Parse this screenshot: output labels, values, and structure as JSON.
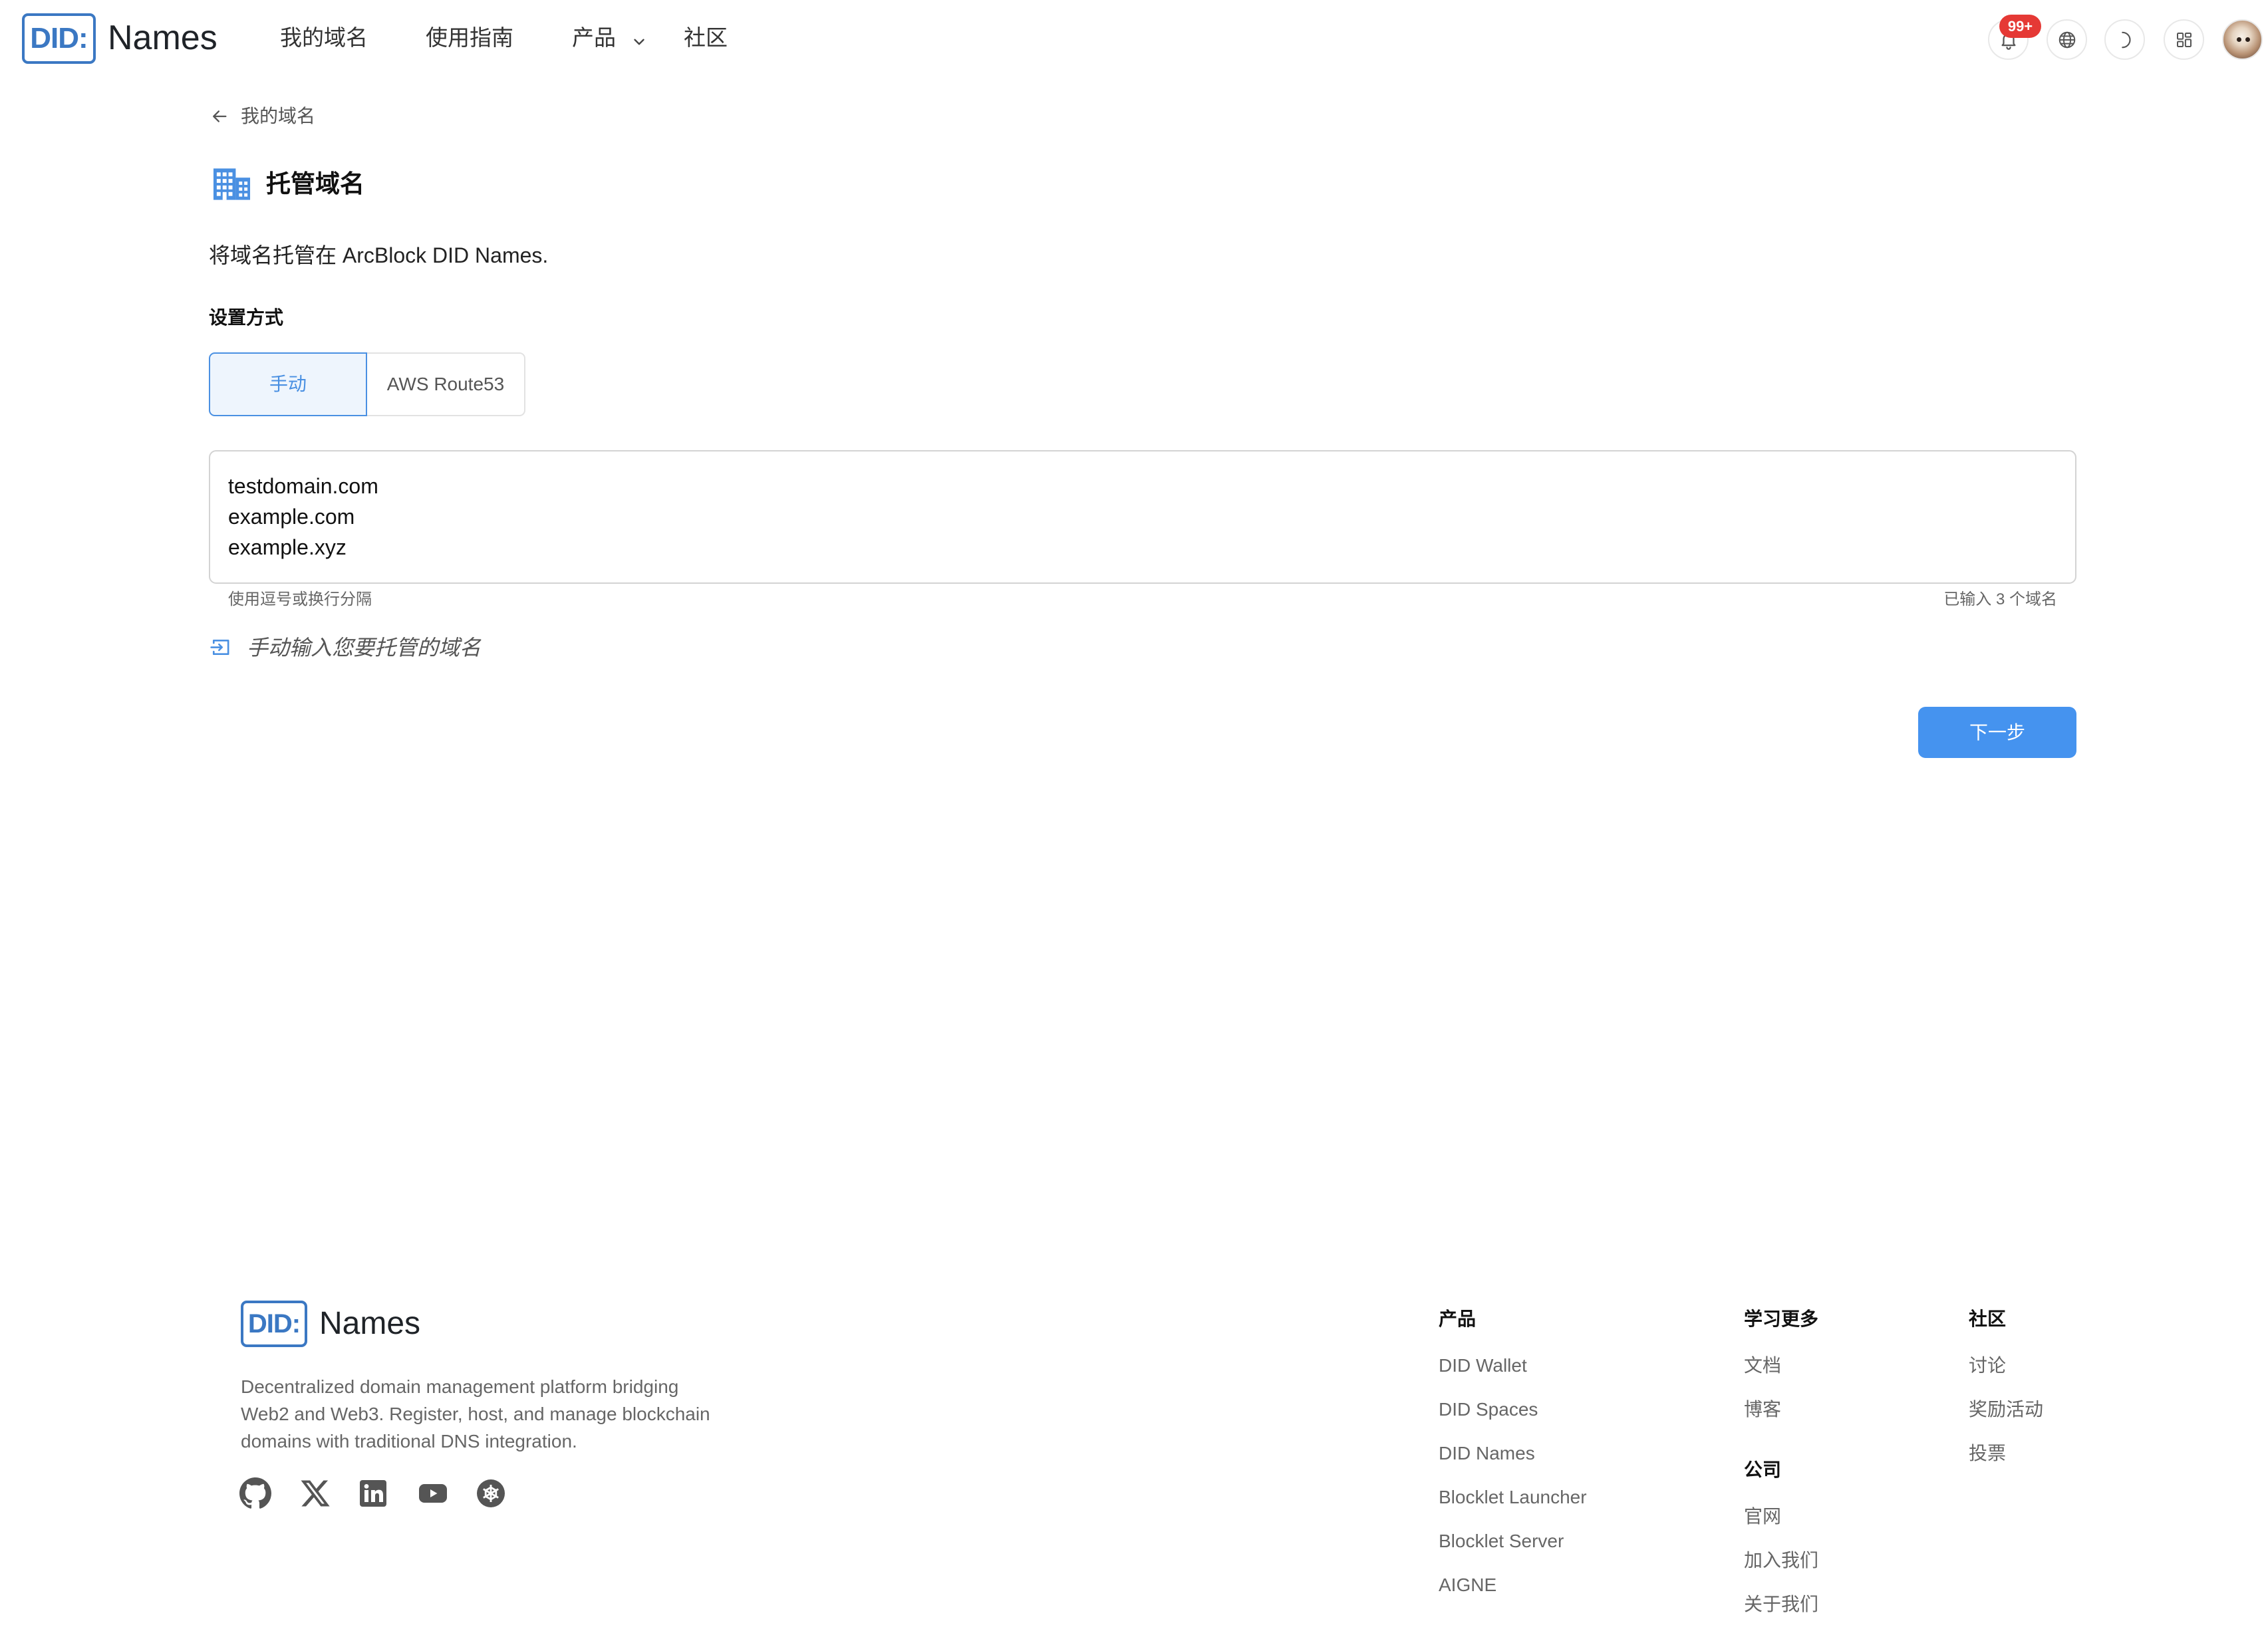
{
  "header": {
    "logo_mark": "DID:",
    "logo_text": "Names",
    "nav": [
      {
        "label": "我的域名"
      },
      {
        "label": "使用指南"
      },
      {
        "label": "产品"
      },
      {
        "label": "社区"
      }
    ],
    "notification_count": "99+",
    "icons": {
      "notifications": "bell-icon",
      "language": "globe-icon",
      "theme": "moon-icon",
      "apps": "grid-icon",
      "account": "avatar"
    }
  },
  "breadcrumb": {
    "back_label": "我的域名"
  },
  "page": {
    "title": "托管域名",
    "title_icon": "building-icon",
    "description": "将域名托管在 ArcBlock DID Names.",
    "method_label": "设置方式",
    "methods": [
      {
        "label": "手动",
        "selected": true
      },
      {
        "label": "AWS Route53",
        "selected": false
      }
    ],
    "domains_value": "testdomain.com\nexample.com\nexample.xyz",
    "helper_text": "使用逗号或换行分隔",
    "count_text": "已输入 3 个域名",
    "manual_hint": "手动输入您要托管的域名",
    "next_button": "下一步"
  },
  "footer": {
    "logo_mark": "DID:",
    "logo_text": "Names",
    "description": "Decentralized domain management platform bridging Web2 and Web3. Register, host, and manage blockchain domains with traditional DNS integration.",
    "social": [
      "github-icon",
      "x-icon",
      "linkedin-icon",
      "youtube-icon",
      "community-icon"
    ],
    "columns": [
      {
        "heading": "产品",
        "items": [
          "DID Wallet",
          "DID Spaces",
          "DID Names",
          "Blocklet Launcher",
          "Blocklet Server",
          "AIGNE"
        ]
      },
      {
        "heading": "学习更多",
        "items": [
          "文档",
          "博客"
        ]
      },
      {
        "heading": "公司",
        "items": [
          "官网",
          "加入我们",
          "关于我们"
        ]
      },
      {
        "heading": "社区",
        "items": [
          "讨论",
          "奖励活动",
          "投票"
        ]
      }
    ]
  },
  "colors": {
    "accent": "#4a90e2",
    "button": "#4593ef",
    "badge": "#e53935",
    "logo": "#3b78c3",
    "text": "#222222",
    "muted": "#666666"
  }
}
